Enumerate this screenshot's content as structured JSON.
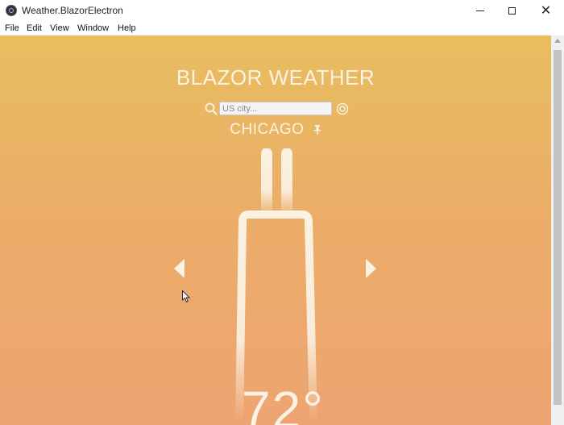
{
  "window": {
    "title": "Weather.BlazorElectron",
    "controls": {
      "minimize_icon": "minimize-icon",
      "maximize_icon": "maximize-icon",
      "close_icon": "close-icon"
    }
  },
  "menu": {
    "items": [
      {
        "label": "File"
      },
      {
        "label": "Edit"
      },
      {
        "label": "View"
      },
      {
        "label": "Window"
      },
      {
        "label": "Help"
      }
    ]
  },
  "app": {
    "title": "BLAZOR WEATHER",
    "search": {
      "placeholder": "US city...",
      "value": ""
    },
    "city": "CHICAGO",
    "temperature": "72°",
    "colors": {
      "gradient_top": "#e8be60",
      "gradient_bottom": "#eda472",
      "text": "#fbf2e3"
    }
  }
}
